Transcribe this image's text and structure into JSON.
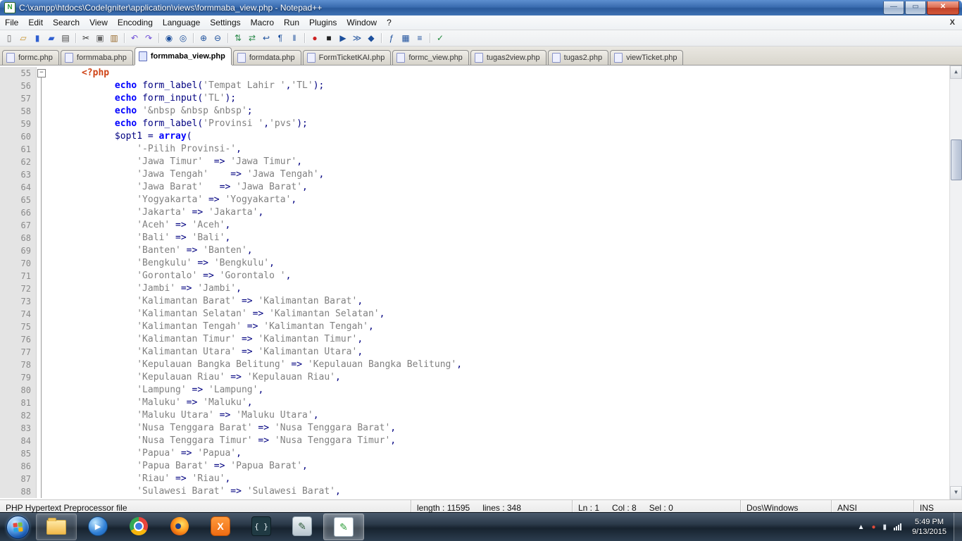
{
  "window": {
    "title": "C:\\xampp\\htdocs\\CodeIgniter\\application\\views\\formmaba_view.php - Notepad++",
    "controls": {
      "minimize": "—",
      "maximize": "▭",
      "close": "✕"
    }
  },
  "menu": {
    "items": [
      "File",
      "Edit",
      "Search",
      "View",
      "Encoding",
      "Language",
      "Settings",
      "Macro",
      "Run",
      "Plugins",
      "Window",
      "?"
    ],
    "close_label": "X"
  },
  "toolbar": {
    "icons": [
      {
        "name": "new-file",
        "glyph": "▯",
        "color": "#666"
      },
      {
        "name": "open-file",
        "glyph": "▱",
        "color": "#c8922c"
      },
      {
        "name": "save-file",
        "glyph": "▮",
        "color": "#2f5fd0"
      },
      {
        "name": "save-all",
        "glyph": "▰",
        "color": "#2f5fd0"
      },
      {
        "name": "print",
        "glyph": "▤",
        "color": "#444"
      },
      {
        "name": "cut",
        "glyph": "✂",
        "color": "#333",
        "sep": true
      },
      {
        "name": "copy",
        "glyph": "▣",
        "color": "#666"
      },
      {
        "name": "paste",
        "glyph": "▥",
        "color": "#996c2e"
      },
      {
        "name": "undo",
        "glyph": "↶",
        "color": "#6f4fd8",
        "sep": true
      },
      {
        "name": "redo",
        "glyph": "↷",
        "color": "#6f4fd8"
      },
      {
        "name": "find",
        "glyph": "◉",
        "color": "#1c4f9c",
        "sep": true
      },
      {
        "name": "replace",
        "glyph": "◎",
        "color": "#1c4f9c"
      },
      {
        "name": "zoom-in",
        "glyph": "⊕",
        "color": "#1c4f9c",
        "sep": true
      },
      {
        "name": "zoom-out",
        "glyph": "⊖",
        "color": "#1c4f9c"
      },
      {
        "name": "sync-vertical",
        "glyph": "⇅",
        "color": "#2c8a4b",
        "sep": true
      },
      {
        "name": "sync-horizontal",
        "glyph": "⇄",
        "color": "#2c8a4b"
      },
      {
        "name": "word-wrap",
        "glyph": "↩",
        "color": "#1c4f9c"
      },
      {
        "name": "show-all-characters",
        "glyph": "¶",
        "color": "#1c4f9c"
      },
      {
        "name": "indent-guide",
        "glyph": "‖",
        "color": "#1c4f9c"
      },
      {
        "name": "record-macro",
        "glyph": "●",
        "color": "#cc2222",
        "sep": true
      },
      {
        "name": "stop-macro",
        "glyph": "■",
        "color": "#222"
      },
      {
        "name": "play-macro",
        "glyph": "▶",
        "color": "#1c4f9c"
      },
      {
        "name": "run-macro-multiple",
        "glyph": "≫",
        "color": "#1c4f9c"
      },
      {
        "name": "save-macro",
        "glyph": "◆",
        "color": "#1c4f9c"
      },
      {
        "name": "function-list",
        "glyph": "ƒ",
        "color": "#1c4f9c",
        "sep": true
      },
      {
        "name": "document-map",
        "glyph": "▦",
        "color": "#1c4f9c"
      },
      {
        "name": "document-switcher",
        "glyph": "≡",
        "color": "#1c4f9c"
      },
      {
        "name": "spell-check",
        "glyph": "✓",
        "color": "#1f8a3a",
        "sep": true
      }
    ]
  },
  "tabs": [
    {
      "label": "formc.php"
    },
    {
      "label": "formmaba.php"
    },
    {
      "label": "formmaba_view.php",
      "active": true
    },
    {
      "label": "formdata.php"
    },
    {
      "label": "FormTicketKAI.php"
    },
    {
      "label": "formc_view.php"
    },
    {
      "label": "tugas2view.php"
    },
    {
      "label": "tugas2.php"
    },
    {
      "label": "viewTicket.php"
    }
  ],
  "editor": {
    "lines": [
      {
        "n": 55,
        "fold": "start",
        "seg": [
          [
            "w",
            "      "
          ],
          [
            "p",
            "<?php"
          ]
        ]
      },
      {
        "n": 56,
        "fold": "line",
        "seg": [
          [
            "w",
            "            "
          ],
          [
            "k",
            "echo"
          ],
          [
            "w",
            " "
          ],
          [
            "i",
            "form_label"
          ],
          [
            "o",
            "("
          ],
          [
            "s",
            "'Tempat Lahir '"
          ],
          [
            "o",
            ","
          ],
          [
            "s",
            "'TL'"
          ],
          [
            "o",
            ");"
          ]
        ]
      },
      {
        "n": 57,
        "fold": "line",
        "seg": [
          [
            "w",
            "            "
          ],
          [
            "k",
            "echo"
          ],
          [
            "w",
            " "
          ],
          [
            "i",
            "form_input"
          ],
          [
            "o",
            "("
          ],
          [
            "s",
            "'TL'"
          ],
          [
            "o",
            ");"
          ]
        ]
      },
      {
        "n": 58,
        "fold": "line",
        "seg": [
          [
            "w",
            "            "
          ],
          [
            "k",
            "echo"
          ],
          [
            "w",
            " "
          ],
          [
            "s",
            "'&nbsp &nbsp &nbsp'"
          ],
          [
            "o",
            ";"
          ]
        ]
      },
      {
        "n": 59,
        "fold": "line",
        "seg": [
          [
            "w",
            "            "
          ],
          [
            "k",
            "echo"
          ],
          [
            "w",
            " "
          ],
          [
            "i",
            "form_label"
          ],
          [
            "o",
            "("
          ],
          [
            "s",
            "'Provinsi '"
          ],
          [
            "o",
            ","
          ],
          [
            "s",
            "'pvs'"
          ],
          [
            "o",
            ");"
          ]
        ]
      },
      {
        "n": 60,
        "fold": "line",
        "seg": [
          [
            "w",
            "            "
          ],
          [
            "i",
            "$opt1"
          ],
          [
            "o",
            " = "
          ],
          [
            "k",
            "array"
          ],
          [
            "o",
            "("
          ]
        ]
      },
      {
        "n": 61,
        "fold": "line",
        "seg": [
          [
            "w",
            "                "
          ],
          [
            "s",
            "'-Pilih Provinsi-'"
          ],
          [
            "o",
            ","
          ]
        ]
      },
      {
        "n": 62,
        "fold": "line",
        "seg": [
          [
            "w",
            "                "
          ],
          [
            "s",
            "'Jawa Timur'"
          ],
          [
            "o",
            "  => "
          ],
          [
            "s",
            "'Jawa Timur'"
          ],
          [
            "o",
            ","
          ]
        ]
      },
      {
        "n": 63,
        "fold": "line",
        "seg": [
          [
            "w",
            "                "
          ],
          [
            "s",
            "'Jawa Tengah'"
          ],
          [
            "o",
            "    => "
          ],
          [
            "s",
            "'Jawa Tengah'"
          ],
          [
            "o",
            ","
          ]
        ]
      },
      {
        "n": 64,
        "fold": "line",
        "seg": [
          [
            "w",
            "                "
          ],
          [
            "s",
            "'Jawa Barat'"
          ],
          [
            "o",
            "   => "
          ],
          [
            "s",
            "'Jawa Barat'"
          ],
          [
            "o",
            ","
          ]
        ]
      },
      {
        "n": 65,
        "fold": "line",
        "seg": [
          [
            "w",
            "                "
          ],
          [
            "s",
            "'Yogyakarta'"
          ],
          [
            "o",
            " => "
          ],
          [
            "s",
            "'Yogyakarta'"
          ],
          [
            "o",
            ","
          ]
        ]
      },
      {
        "n": 66,
        "fold": "line",
        "seg": [
          [
            "w",
            "                "
          ],
          [
            "s",
            "'Jakarta'"
          ],
          [
            "o",
            " => "
          ],
          [
            "s",
            "'Jakarta'"
          ],
          [
            "o",
            ","
          ]
        ]
      },
      {
        "n": 67,
        "fold": "line",
        "seg": [
          [
            "w",
            "                "
          ],
          [
            "s",
            "'Aceh'"
          ],
          [
            "o",
            " => "
          ],
          [
            "s",
            "'Aceh'"
          ],
          [
            "o",
            ","
          ]
        ]
      },
      {
        "n": 68,
        "fold": "line",
        "seg": [
          [
            "w",
            "                "
          ],
          [
            "s",
            "'Bali'"
          ],
          [
            "o",
            " => "
          ],
          [
            "s",
            "'Bali'"
          ],
          [
            "o",
            ","
          ]
        ]
      },
      {
        "n": 69,
        "fold": "line",
        "seg": [
          [
            "w",
            "                "
          ],
          [
            "s",
            "'Banten'"
          ],
          [
            "o",
            " => "
          ],
          [
            "s",
            "'Banten'"
          ],
          [
            "o",
            ","
          ]
        ]
      },
      {
        "n": 70,
        "fold": "line",
        "seg": [
          [
            "w",
            "                "
          ],
          [
            "s",
            "'Bengkulu'"
          ],
          [
            "o",
            " => "
          ],
          [
            "s",
            "'Bengkulu'"
          ],
          [
            "o",
            ","
          ]
        ]
      },
      {
        "n": 71,
        "fold": "line",
        "seg": [
          [
            "w",
            "                "
          ],
          [
            "s",
            "'Gorontalo'"
          ],
          [
            "o",
            " => "
          ],
          [
            "s",
            "'Gorontalo '"
          ],
          [
            "o",
            ","
          ]
        ]
      },
      {
        "n": 72,
        "fold": "line",
        "seg": [
          [
            "w",
            "                "
          ],
          [
            "s",
            "'Jambi'"
          ],
          [
            "o",
            " => "
          ],
          [
            "s",
            "'Jambi'"
          ],
          [
            "o",
            ","
          ]
        ]
      },
      {
        "n": 73,
        "fold": "line",
        "seg": [
          [
            "w",
            "                "
          ],
          [
            "s",
            "'Kalimantan Barat'"
          ],
          [
            "o",
            " => "
          ],
          [
            "s",
            "'Kalimantan Barat'"
          ],
          [
            "o",
            ","
          ]
        ]
      },
      {
        "n": 74,
        "fold": "line",
        "seg": [
          [
            "w",
            "                "
          ],
          [
            "s",
            "'Kalimantan Selatan'"
          ],
          [
            "o",
            " => "
          ],
          [
            "s",
            "'Kalimantan Selatan'"
          ],
          [
            "o",
            ","
          ]
        ]
      },
      {
        "n": 75,
        "fold": "line",
        "seg": [
          [
            "w",
            "                "
          ],
          [
            "s",
            "'Kalimantan Tengah'"
          ],
          [
            "o",
            " => "
          ],
          [
            "s",
            "'Kalimantan Tengah'"
          ],
          [
            "o",
            ","
          ]
        ]
      },
      {
        "n": 76,
        "fold": "line",
        "seg": [
          [
            "w",
            "                "
          ],
          [
            "s",
            "'Kalimantan Timur'"
          ],
          [
            "o",
            " => "
          ],
          [
            "s",
            "'Kalimantan Timur'"
          ],
          [
            "o",
            ","
          ]
        ]
      },
      {
        "n": 77,
        "fold": "line",
        "seg": [
          [
            "w",
            "                "
          ],
          [
            "s",
            "'Kalimantan Utara'"
          ],
          [
            "o",
            " => "
          ],
          [
            "s",
            "'Kalimantan Utara'"
          ],
          [
            "o",
            ","
          ]
        ]
      },
      {
        "n": 78,
        "fold": "line",
        "seg": [
          [
            "w",
            "                "
          ],
          [
            "s",
            "'Kepulauan Bangka Belitung'"
          ],
          [
            "o",
            " => "
          ],
          [
            "s",
            "'Kepulauan Bangka Belitung'"
          ],
          [
            "o",
            ","
          ]
        ]
      },
      {
        "n": 79,
        "fold": "line",
        "seg": [
          [
            "w",
            "                "
          ],
          [
            "s",
            "'Kepulauan Riau'"
          ],
          [
            "o",
            " => "
          ],
          [
            "s",
            "'Kepulauan Riau'"
          ],
          [
            "o",
            ","
          ]
        ]
      },
      {
        "n": 80,
        "fold": "line",
        "seg": [
          [
            "w",
            "                "
          ],
          [
            "s",
            "'Lampung'"
          ],
          [
            "o",
            " => "
          ],
          [
            "s",
            "'Lampung'"
          ],
          [
            "o",
            ","
          ]
        ]
      },
      {
        "n": 81,
        "fold": "line",
        "seg": [
          [
            "w",
            "                "
          ],
          [
            "s",
            "'Maluku'"
          ],
          [
            "o",
            " => "
          ],
          [
            "s",
            "'Maluku'"
          ],
          [
            "o",
            ","
          ]
        ]
      },
      {
        "n": 82,
        "fold": "line",
        "seg": [
          [
            "w",
            "                "
          ],
          [
            "s",
            "'Maluku Utara'"
          ],
          [
            "o",
            " => "
          ],
          [
            "s",
            "'Maluku Utara'"
          ],
          [
            "o",
            ","
          ]
        ]
      },
      {
        "n": 83,
        "fold": "line",
        "seg": [
          [
            "w",
            "                "
          ],
          [
            "s",
            "'Nusa Tenggara Barat'"
          ],
          [
            "o",
            " => "
          ],
          [
            "s",
            "'Nusa Tenggara Barat'"
          ],
          [
            "o",
            ","
          ]
        ]
      },
      {
        "n": 84,
        "fold": "line",
        "seg": [
          [
            "w",
            "                "
          ],
          [
            "s",
            "'Nusa Tenggara Timur'"
          ],
          [
            "o",
            " => "
          ],
          [
            "s",
            "'Nusa Tenggara Timur'"
          ],
          [
            "o",
            ","
          ]
        ]
      },
      {
        "n": 85,
        "fold": "line",
        "seg": [
          [
            "w",
            "                "
          ],
          [
            "s",
            "'Papua'"
          ],
          [
            "o",
            " => "
          ],
          [
            "s",
            "'Papua'"
          ],
          [
            "o",
            ","
          ]
        ]
      },
      {
        "n": 86,
        "fold": "line",
        "seg": [
          [
            "w",
            "                "
          ],
          [
            "s",
            "'Papua Barat'"
          ],
          [
            "o",
            " => "
          ],
          [
            "s",
            "'Papua Barat'"
          ],
          [
            "o",
            ","
          ]
        ]
      },
      {
        "n": 87,
        "fold": "line",
        "seg": [
          [
            "w",
            "                "
          ],
          [
            "s",
            "'Riau'"
          ],
          [
            "o",
            " => "
          ],
          [
            "s",
            "'Riau'"
          ],
          [
            "o",
            ","
          ]
        ]
      },
      {
        "n": 88,
        "fold": "line",
        "seg": [
          [
            "w",
            "                "
          ],
          [
            "s",
            "'Sulawesi Barat'"
          ],
          [
            "o",
            " => "
          ],
          [
            "s",
            "'Sulawesi Barat'"
          ],
          [
            "o",
            ","
          ]
        ]
      }
    ]
  },
  "status": {
    "doc_type": "PHP Hypertext Preprocessor file",
    "length_text": "length : 11595",
    "lines_text": "lines : 348",
    "ln_text": "Ln : 1",
    "col_text": "Col : 8",
    "sel_text": "Sel : 0",
    "eol": "Dos\\Windows",
    "encoding": "ANSI",
    "insert_mode": "INS"
  },
  "taskbar": {
    "buttons": [
      {
        "name": "windows-explorer",
        "kind": "folder",
        "highlight": true
      },
      {
        "name": "media-player",
        "kind": "wmp"
      },
      {
        "name": "chrome",
        "kind": "chrome"
      },
      {
        "name": "firefox",
        "kind": "firefox"
      },
      {
        "name": "xampp",
        "kind": "xampp",
        "glyph": "X"
      },
      {
        "name": "code-editor",
        "kind": "braces",
        "glyph": "{ }"
      },
      {
        "name": "design-tool",
        "kind": "design",
        "glyph": "✎"
      },
      {
        "name": "notepadpp",
        "kind": "npp",
        "glyph": "✎",
        "active": true
      }
    ],
    "tray": [
      {
        "name": "hidden-icons",
        "kind": "glyph",
        "glyph": "▲",
        "color": "#eef3f8"
      },
      {
        "name": "security-alert",
        "kind": "glyph",
        "glyph": "●",
        "color": "#e04b3a"
      },
      {
        "name": "device",
        "kind": "glyph",
        "glyph": "▮",
        "color": "#dfe6ee"
      },
      {
        "name": "network",
        "kind": "net"
      }
    ],
    "clock": {
      "time": "5:49 PM",
      "date": "9/13/2015"
    }
  }
}
